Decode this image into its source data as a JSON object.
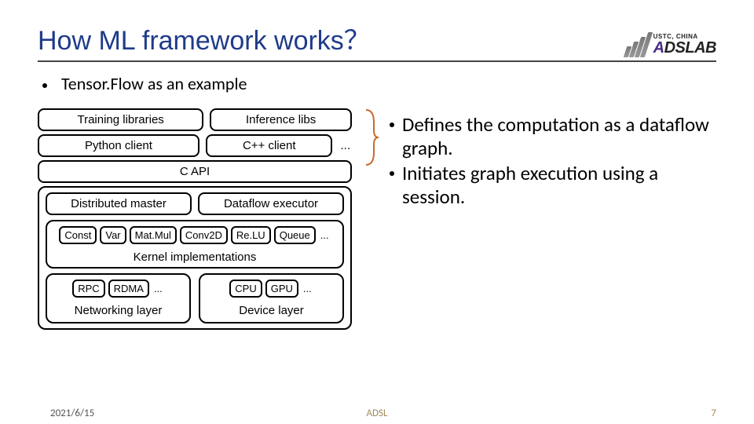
{
  "header": {
    "title": "How ML framework works？",
    "logo_line1": "USTC, CHINA",
    "logo_a": "A",
    "logo_rest": "DSLAB"
  },
  "subtitle_prefix": "Tensor.Flow",
  "subtitle_suffix": " as an example",
  "diagram": {
    "training_libs": "Training libraries",
    "inference_libs": "Inference libs",
    "python_client": "Python client",
    "cpp_client": "C++ client",
    "ellipsis": "...",
    "c_api": "C API",
    "dist_master": "Distributed master",
    "dataflow_exec": "Dataflow executor",
    "ops": {
      "const": "Const",
      "var": "Var",
      "matmul": "Mat.Mul",
      "conv2d": "Conv2D",
      "relu": "Re.LU",
      "queue": "Queue"
    },
    "kernel_label": "Kernel implementations",
    "net": {
      "rpc": "RPC",
      "rdma": "RDMA"
    },
    "net_label": "Networking layer",
    "dev": {
      "cpu": "CPU",
      "gpu": "GPU"
    },
    "dev_label": "Device layer"
  },
  "explain": {
    "p1": "Defines the computation as a dataflow graph.",
    "p2": "Initiates graph execution using a session."
  },
  "footer": {
    "date": "2021/6/15",
    "center": "ADSL",
    "page": "7"
  }
}
